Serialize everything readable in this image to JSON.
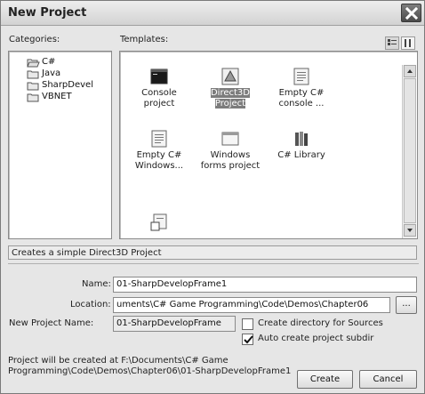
{
  "window": {
    "title": "New Project"
  },
  "categories": {
    "label": "Categories:",
    "items": [
      {
        "label": "C#",
        "selected": true
      },
      {
        "label": "Java"
      },
      {
        "label": "SharpDevel"
      },
      {
        "label": "VBNET"
      }
    ]
  },
  "templates": {
    "label": "Templates:",
    "items": [
      {
        "label": "Console\nproject",
        "icon": "console-project-icon"
      },
      {
        "label": "Direct3D\nProject",
        "icon": "direct3d-project-icon",
        "selected": true
      },
      {
        "label": "Empty C#\nconsole ...",
        "icon": "empty-csharp-console-icon"
      },
      {
        "label": "Empty C#\nWindows...",
        "icon": "empty-csharp-windows-icon"
      },
      {
        "label": "Windows\nforms project",
        "icon": "windows-forms-icon"
      },
      {
        "label": "C# Library",
        "icon": "csharp-library-icon"
      },
      {
        "label": "",
        "icon": "partial-template-icon"
      }
    ]
  },
  "description": "Creates a simple Direct3D Project",
  "form": {
    "name_label": "Name:",
    "name_value": "01-SharpDevelopFrame1",
    "location_label": "Location:",
    "location_value": "uments\\C# Game Programming\\Code\\Demos\\Chapter06",
    "browse_label": "...",
    "new_project_name_label": "New Project Name:",
    "new_project_name_value": "01-SharpDevelopFrame",
    "create_dir_label": "Create directory for Sources",
    "create_dir_checked": false,
    "auto_subdir_label": "Auto create project subdir",
    "auto_subdir_checked": true
  },
  "footer": {
    "path_note": "Project will be created at F:\\Documents\\C# Game Programming\\Code\\Demos\\Chapter06\\01-SharpDevelopFrame1",
    "create_label": "Create",
    "cancel_label": "Cancel"
  },
  "colors": {
    "selection": "#7c7c7c",
    "title_bar": "#dedede"
  }
}
